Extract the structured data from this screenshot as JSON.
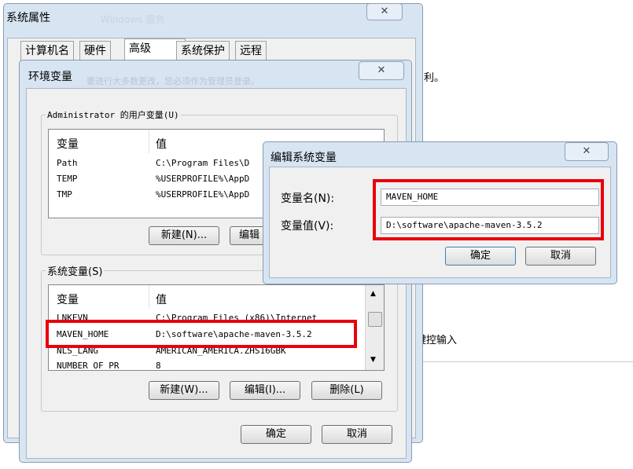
{
  "background_window": {
    "text_top": "利。",
    "text_mid": "鍵控输入"
  },
  "system_properties": {
    "title": "系统属性",
    "faded_title": "Windows 服务",
    "tabs": [
      "计算机名",
      "硬件",
      "高级",
      "系统保护",
      "远程"
    ]
  },
  "env_dialog": {
    "title": "环境变量",
    "faded_text": "要进行大多数更改，您必须作为管理员登录。",
    "user_group": "Administrator 的用户变量(U)",
    "system_group": "系统变量(S)",
    "col_var": "变量",
    "col_val": "值",
    "user_rows": [
      {
        "name": "Path",
        "value": "C:\\Program Files\\D"
      },
      {
        "name": "TEMP",
        "value": "%USERPROFILE%\\AppD"
      },
      {
        "name": "TMP",
        "value": "%USERPROFILE%\\AppD"
      }
    ],
    "system_rows": [
      {
        "name": "LNKEVN",
        "value": "C:\\Program Files (x86)\\Internet"
      },
      {
        "name": "MAVEN_HOME",
        "value": "D:\\software\\apache-maven-3.5.2"
      },
      {
        "name": "NLS_LANG",
        "value": "AMERICAN_AMERICA.ZHS16GBK"
      },
      {
        "name": "NUMBER_OF_PR",
        "value": "8"
      }
    ],
    "user_new": "新建(N)...",
    "user_edit": "编辑",
    "sys_new": "新建(W)...",
    "sys_edit": "编辑(I)...",
    "sys_delete": "删除(L)",
    "ok": "确定",
    "cancel": "取消"
  },
  "edit_dialog": {
    "title": "编辑系统变量",
    "name_label": "变量名(N):",
    "value_label": "变量值(V):",
    "name_value": "MAVEN_HOME",
    "value_value": "D:\\software\\apache-maven-3.5.2",
    "ok": "确定",
    "cancel": "取消"
  },
  "icons": {
    "close": "close-icon",
    "scroll_up": "scroll-up-icon",
    "scroll_down": "scroll-down-icon"
  },
  "colors": {
    "highlight": "#e8000b",
    "chrome": "#d7e4f2"
  }
}
